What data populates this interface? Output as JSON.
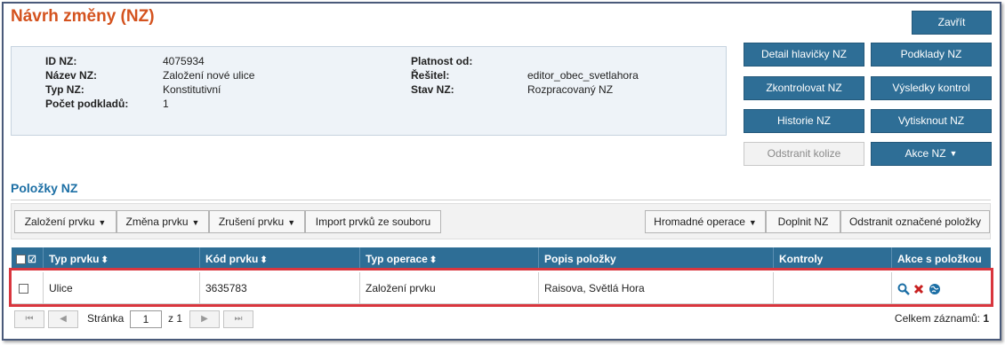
{
  "header": {
    "title": "Návrh změny (NZ)",
    "close_label": "Zavřít"
  },
  "info": {
    "left": [
      {
        "label": "ID NZ:",
        "value": "4075934"
      },
      {
        "label": "Název NZ:",
        "value": "Založení nové ulice"
      },
      {
        "label": "Typ NZ:",
        "value": "Konstitutivní"
      },
      {
        "label": "Počet podkladů:",
        "value": "1"
      }
    ],
    "right": [
      {
        "label": "Platnost od:",
        "value": ""
      },
      {
        "label": "Řešitel:",
        "value": "editor_obec_svetlahora"
      },
      {
        "label": "Stav NZ:",
        "value": "Rozpracovaný NZ"
      }
    ]
  },
  "actions": {
    "detail": "Detail hlavičky NZ",
    "podklady": "Podklady NZ",
    "zkontrolovat": "Zkontrolovat NZ",
    "vysledky": "Výsledky kontrol",
    "historie": "Historie NZ",
    "vytisknout": "Vytisknout NZ",
    "odstranit_kolize": "Odstranit kolize",
    "akce": "Akce NZ"
  },
  "items_section": {
    "title": "Položky NZ"
  },
  "toolbar": {
    "zalozeni": "Založení prvku",
    "zmena": "Změna prvku",
    "zruseni": "Zrušení prvku",
    "import": "Import prvků ze souboru",
    "hromadne": "Hromadné operace",
    "doplnit": "Doplnit NZ",
    "odstranit": "Odstranit označené položky"
  },
  "table": {
    "columns": [
      "Typ prvku",
      "Kód prvku",
      "Typ operace",
      "Popis položky",
      "Kontroly",
      "Akce s položkou"
    ],
    "rows": [
      {
        "typ_prvku": "Ulice",
        "kod": "3635783",
        "operace": "Založení prvku",
        "popis": "Raisova, Světlá Hora",
        "kontroly": ""
      }
    ]
  },
  "pager": {
    "page_label": "Stránka",
    "page_value": "1",
    "of_label": "z 1",
    "total_label": "Celkem záznamů:",
    "total_value": "1"
  },
  "colors": {
    "title": "#d4531f",
    "primary": "#2e6e96",
    "highlight": "#d9363e",
    "section": "#1c6fa5"
  }
}
